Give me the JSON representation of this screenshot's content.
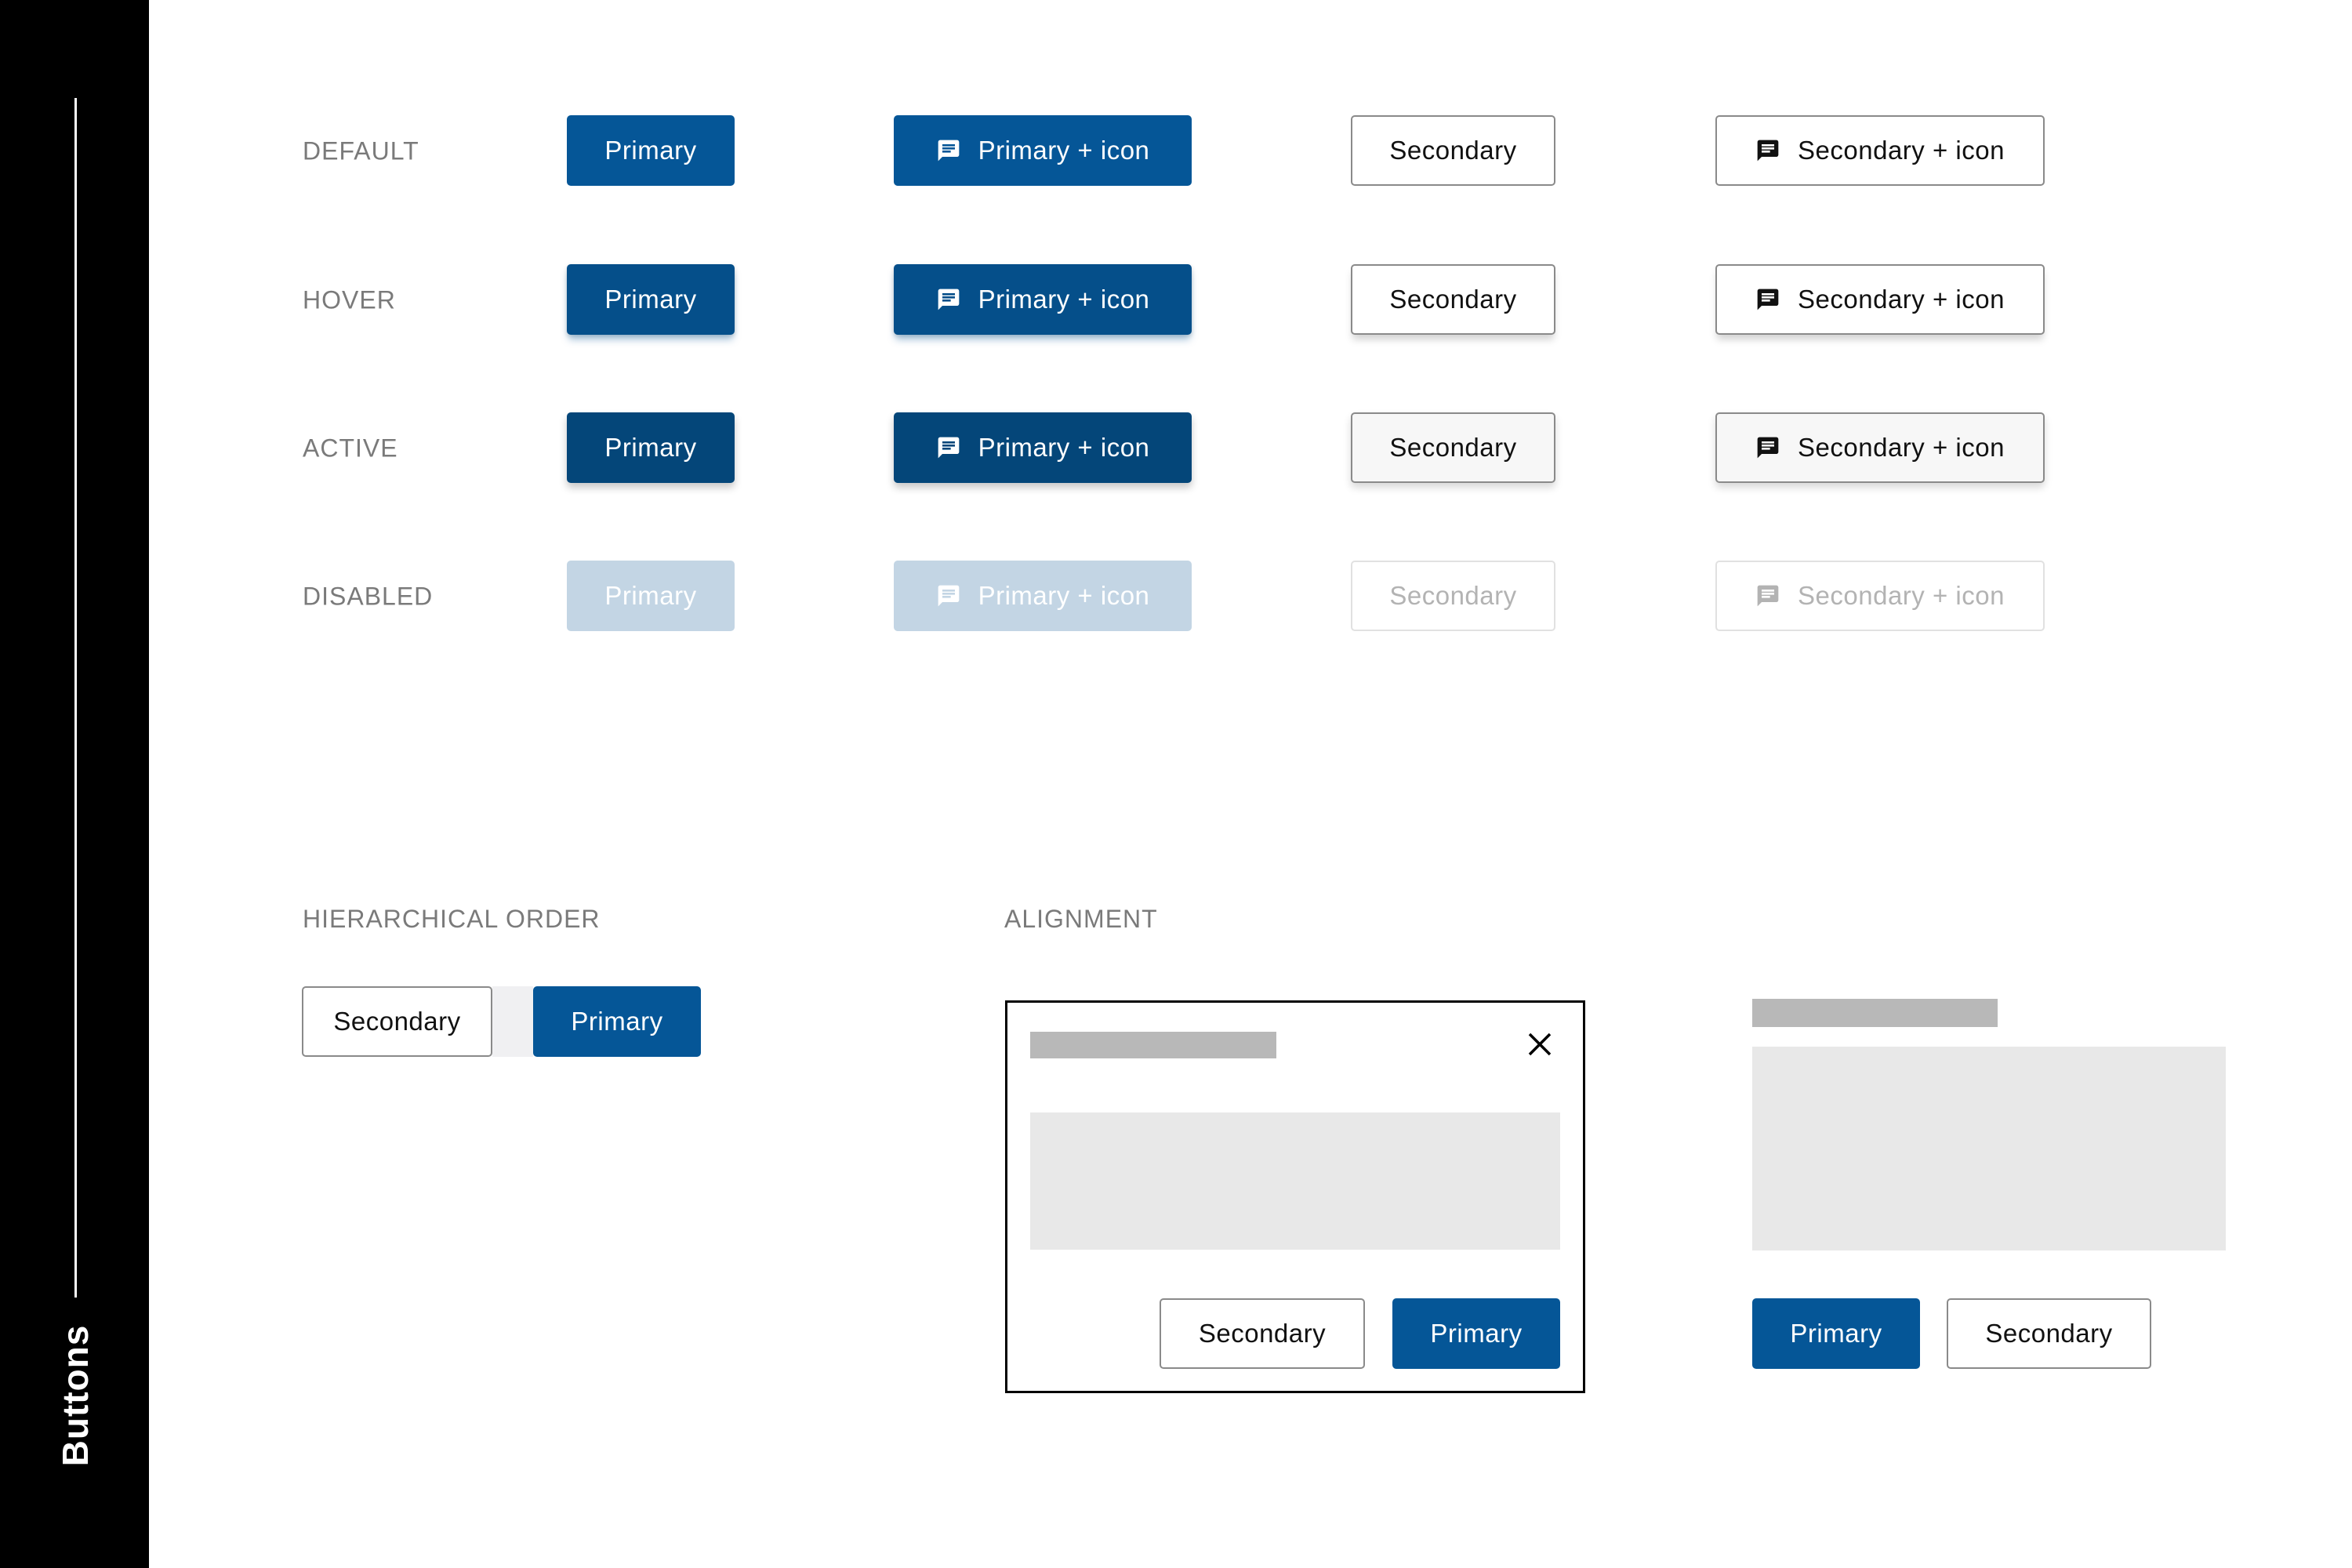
{
  "sidebar": {
    "title": "Buttons"
  },
  "states": [
    {
      "key": "default",
      "label": "DEFAULT"
    },
    {
      "key": "hover",
      "label": "HOVER"
    },
    {
      "key": "active",
      "label": "ACTIVE"
    },
    {
      "key": "disabled",
      "label": "DISABLED"
    }
  ],
  "button_labels": {
    "primary": "Primary",
    "primary_icon": "Primary + icon",
    "secondary": "Secondary",
    "secondary_icon": "Secondary + icon"
  },
  "icons": {
    "button_icon": "message-icon",
    "dialog_close": "close-icon"
  },
  "sections": {
    "hierarchical_order": {
      "label": "HIERARCHICAL ORDER",
      "buttons": [
        "Secondary",
        "Primary"
      ]
    },
    "alignment": {
      "label": "ALIGNMENT",
      "dialog_buttons": [
        "Secondary",
        "Primary"
      ],
      "page_buttons": [
        "Primary",
        "Secondary"
      ]
    }
  },
  "colors": {
    "primary": "#055697",
    "primary_hover": "#054f8a",
    "primary_active": "#044679",
    "primary_disabled": "#c3d5e4",
    "secondary_border": "#8a8a8a",
    "secondary_disabled_text": "#b3b3b3",
    "label_text": "#7a7a7a",
    "sidebar_bg": "#000000"
  }
}
